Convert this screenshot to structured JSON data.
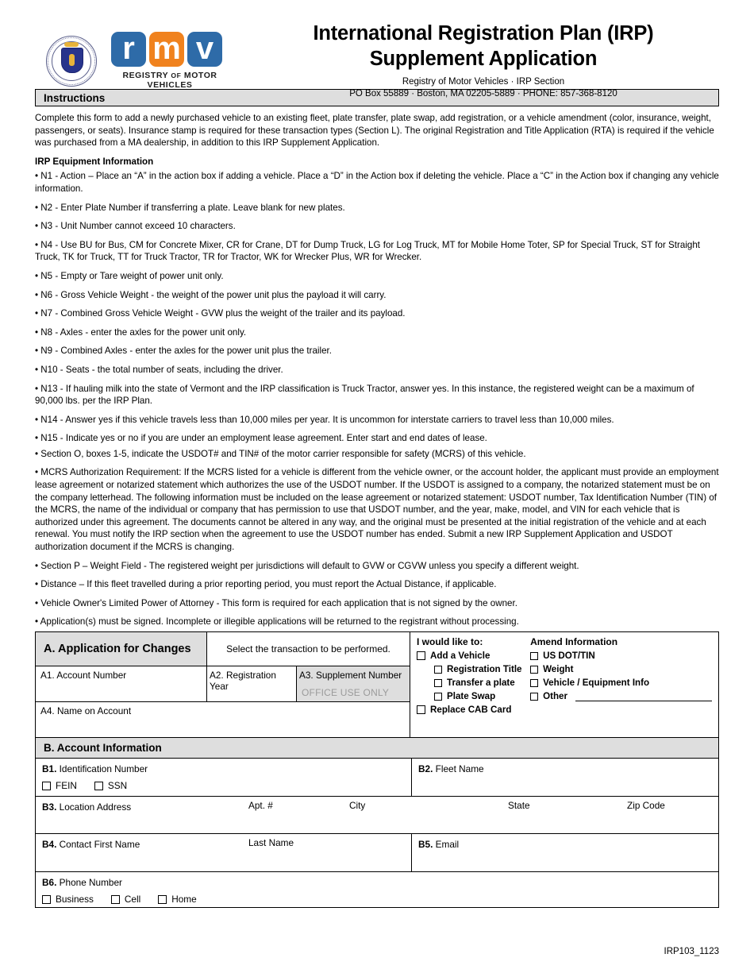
{
  "header": {
    "title_line1": "International Registration Plan (IRP)",
    "title_line2": "Supplement Application",
    "subtitle_line1": "Registry of Motor Vehicles · IRP Section",
    "subtitle_line2": "PO Box 55889 · Boston, MA 02205-5889 · PHONE: 857-368-8120",
    "logo": {
      "tiles": [
        "r",
        "m",
        "v"
      ],
      "caption_part1": "REGISTRY ",
      "caption_of": "OF",
      "caption_part2": " MOTOR VEHICLES",
      "blue": "#2E6BA8",
      "orange": "#F0821E"
    },
    "seal_name": "massachusetts-state-seal"
  },
  "instructions": {
    "band_label": "Instructions",
    "intro": "Complete this form to add a newly purchased vehicle to an existing fleet, plate transfer, plate swap, add registration, or a vehicle amendment (color, insurance, weight, passengers, or seats). Insurance stamp is required for these transaction types (Section L). The original Registration and Title Application (RTA) is required if the vehicle was purchased from a MA dealership, in addition to this IRP Supplement Application.",
    "subheading": "IRP Equipment Information",
    "bullets": [
      "• N1 - Action – Place an “A” in the action box if adding a vehicle. Place a “D” in the Action box if deleting the vehicle. Place a “C” in the Action box if changing any vehicle information.",
      "• N2 - Enter Plate Number if transferring a plate. Leave blank for new plates.",
      "• N3 - Unit Number cannot exceed 10 characters.",
      "• N4 - Use BU for Bus, CM for Concrete Mixer, CR for Crane, DT for Dump Truck, LG for Log Truck, MT for Mobile Home Toter, SP for Special Truck, ST for Straight Truck, TK for Truck, TT for Truck Tractor, TR for Tractor, WK for Wrecker Plus, WR for Wrecker.",
      "• N5 - Empty or Tare weight of power unit only.",
      "• N6 - Gross Vehicle Weight - the weight of the power unit plus the payload it will carry.",
      "• N7 - Combined Gross Vehicle Weight - GVW plus the weight of the trailer and its payload.",
      "• N8 - Axles - enter the axles for the power unit only.",
      "• N9 - Combined Axles - enter the axles for the power unit plus the trailer.",
      "• N10 - Seats - the total number of seats, including the driver.",
      "• N13 - If hauling milk into the state of Vermont and the IRP classification is Truck Tractor, answer yes. In this instance, the registered weight can be a maximum of 90,000 lbs. per the IRP Plan.",
      "• N14 - Answer yes if this vehicle travels less than 10,000 miles per year. It is uncommon for interstate carriers to travel less than 10,000 miles.",
      "• N15 - Indicate yes or no if you are under an employment lease agreement. Enter start and end dates of lease.",
      "• Section O, boxes 1-5, indicate the USDOT# and TIN# of the motor carrier responsible for safety (MCRS) of this vehicle.",
      "• MCRS Authorization Requirement: If the MCRS listed for a vehicle is different from the vehicle owner, or the account holder, the applicant must provide an employment lease agreement or notarized statement which authorizes the use of the USDOT number. If the USDOT is assigned to a company, the notarized statement must be on the company letterhead. The following information must be included on the lease agreement or notarized statement: USDOT number, Tax Identification Number (TIN) of the MCRS, the name of the individual or company that has permission to use that USDOT number, and the year, make, model, and VIN for each vehicle that is authorized under this agreement. The documents cannot be altered in any way, and the original must be presented at the initial registration of the vehicle and at each renewal. You must notify the IRP section when the agreement to use the USDOT number has ended. Submit a new IRP Supplement Application and USDOT authorization document if the MCRS is changing.",
      "• Section P – Weight Field - The registered weight per jurisdictions will default to GVW or CGVW unless you specify a different weight.",
      "• Distance – If this fleet travelled during a prior reporting period, you must report the Actual Distance, if applicable.",
      "• Vehicle Owner's Limited Power of Attorney - This form is required for each application that is not signed by the owner.",
      "• Application(s) must be signed. Incomplete or illegible applications will be returned to the registrant without processing."
    ]
  },
  "section_a": {
    "title": "A. Application for Changes",
    "select_text": "Select the transaction to be performed.",
    "a1_label": "A1. Account Number",
    "a2_label": "A2. Registration Year",
    "a3_label": "A3. Supplement Number",
    "a3_note": "OFFICE USE ONLY",
    "a4_label": "A4. Name on Account",
    "left_heading": "I would like to:",
    "right_heading": "Amend Information",
    "left_items": [
      {
        "label": "Add a Vehicle",
        "indent": false
      },
      {
        "label": "Registration Title",
        "indent": true
      },
      {
        "label": "Transfer a plate",
        "indent": true
      },
      {
        "label": "Plate Swap",
        "indent": true
      },
      {
        "label": "Replace CAB Card",
        "indent": false
      }
    ],
    "right_items": [
      {
        "label": "US DOT/TIN",
        "line": false
      },
      {
        "label": "Weight",
        "line": false
      },
      {
        "label": "Vehicle / Equipment Info",
        "line": false
      },
      {
        "label": "Other",
        "line": true
      }
    ]
  },
  "section_b": {
    "title": "B. Account Information",
    "b1_num": "B1.",
    "b1_label": "Identification Number",
    "b1_options": [
      "FEIN",
      "SSN"
    ],
    "b2_num": "B2.",
    "b2_label": "Fleet Name",
    "b3_num": "B3.",
    "b3_label": "Location Address",
    "b3_apt": "Apt. #",
    "b3_city": "City",
    "b3_state": "State",
    "b3_zip": "Zip Code",
    "b4_num": "B4.",
    "b4_label": "Contact First Name",
    "b4_last": "Last Name",
    "b5_num": "B5.",
    "b5_label": "Email",
    "b6_num": "B6.",
    "b6_label": "Phone Number",
    "b6_options": [
      "Business",
      "Cell",
      "Home"
    ]
  },
  "footer": {
    "form_code": "IRP103_1123"
  }
}
